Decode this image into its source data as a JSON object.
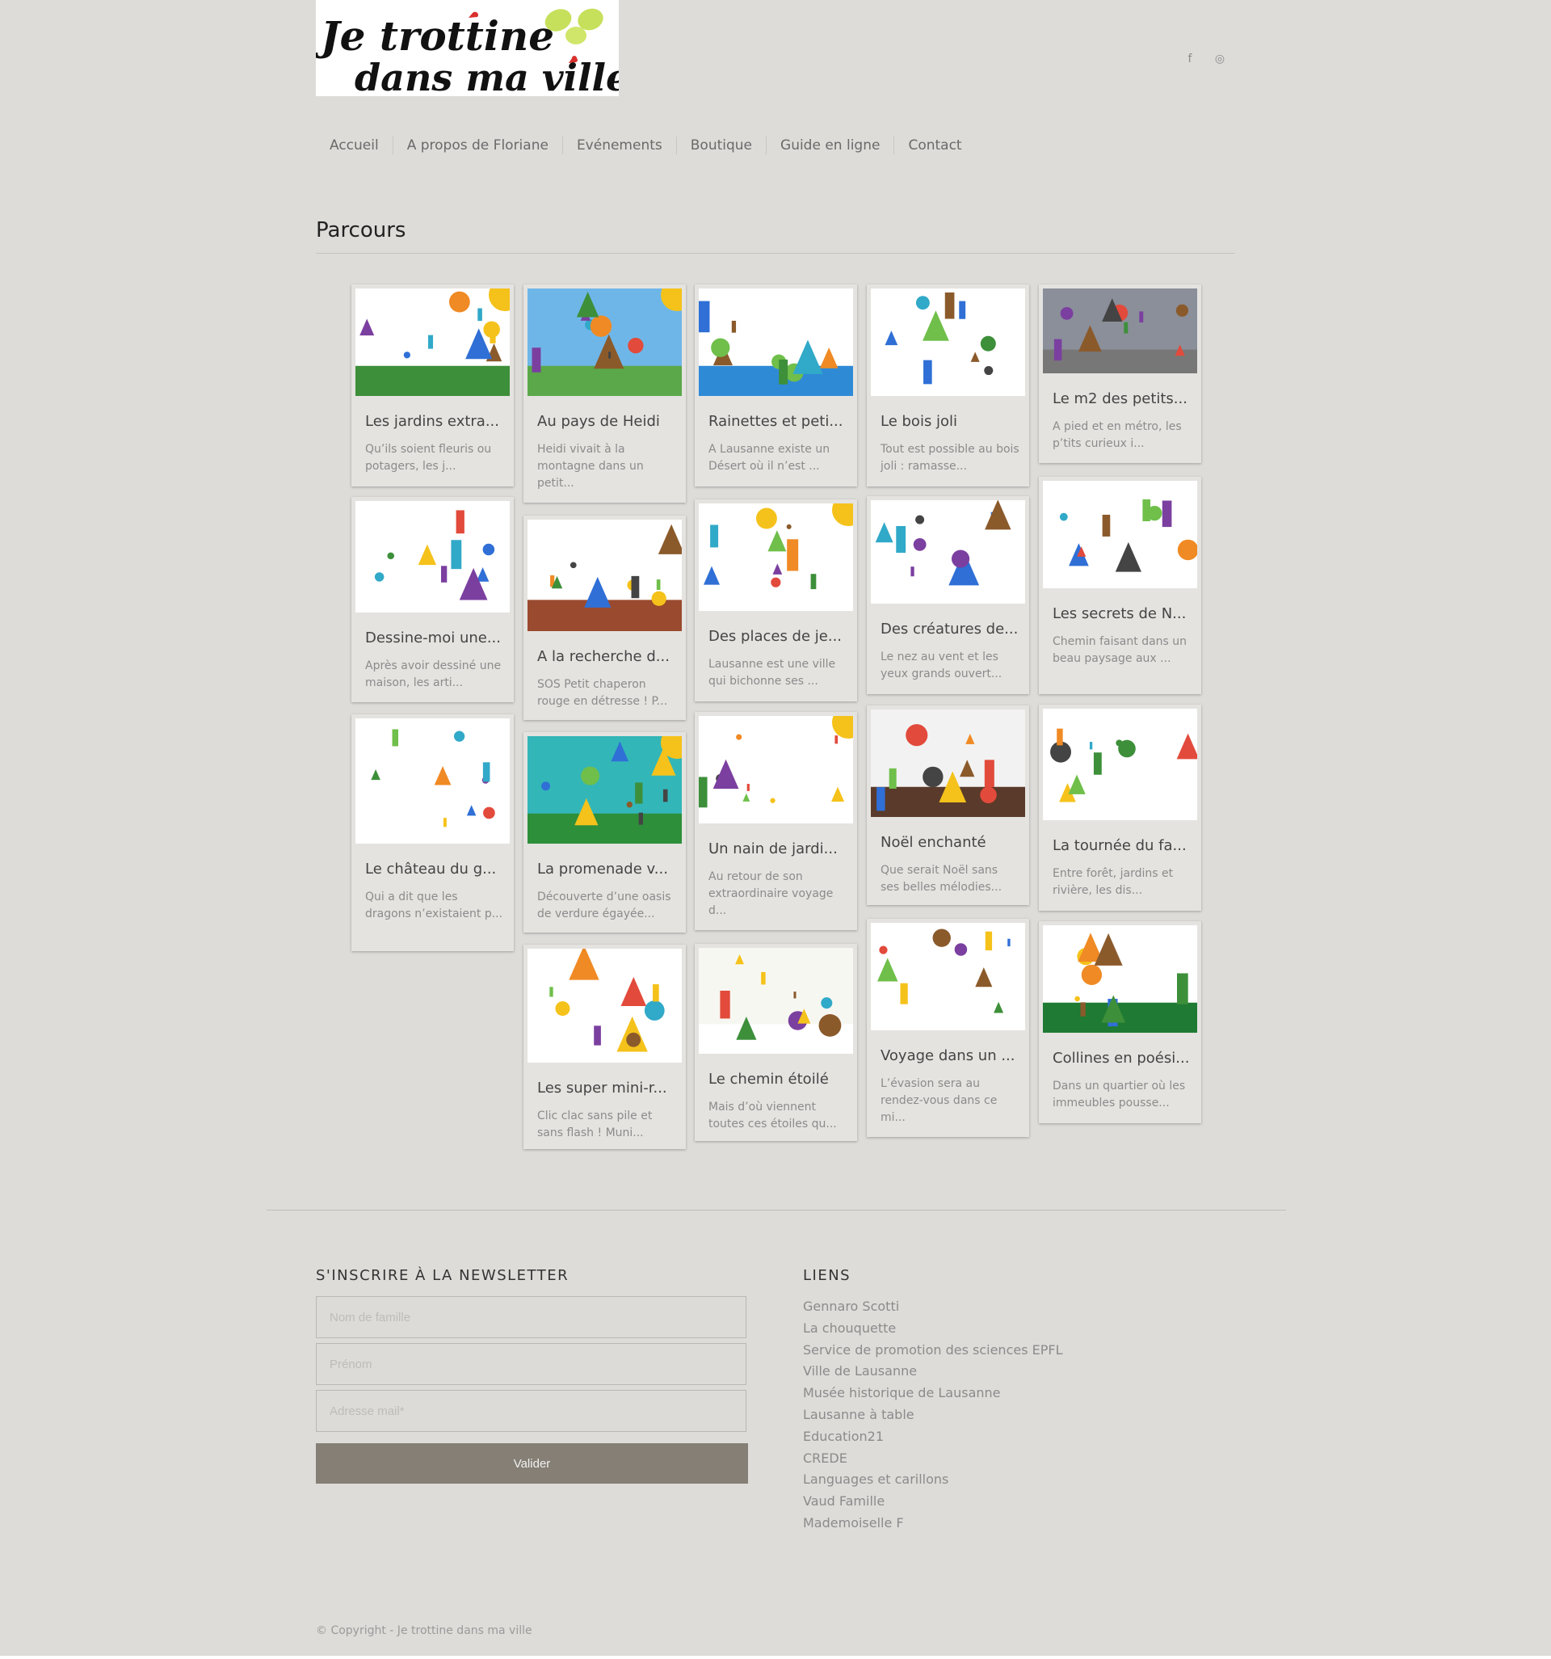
{
  "header": {
    "logo_text": [
      "Je trottine",
      "dans ma ville"
    ],
    "social": {
      "facebook_icon": "f",
      "instagram_icon": "◎"
    }
  },
  "nav": {
    "items": [
      "Accueil",
      "A propos de Floriane",
      "Evénements",
      "Boutique",
      "Guide en ligne",
      "Contact"
    ]
  },
  "page": {
    "title": "Parcours"
  },
  "cards": [
    {
      "title": "Les jardins extra...",
      "excerpt": "Qu’ils soient fleuris ou potagers, les j...",
      "icon": "garden-drawing"
    },
    {
      "title": "Au pays de Heidi",
      "excerpt": "Heidi vivait à la montagne dans un petit...",
      "icon": "mountain-drawing"
    },
    {
      "title": "Rainettes et peti...",
      "excerpt": "A Lausanne existe un Désert où il n’est ...",
      "icon": "frog-drawing"
    },
    {
      "title": "Le bois joli",
      "excerpt": "Tout est possible au bois joli : ramasse...",
      "icon": "forest-drawing"
    },
    {
      "title": "Le m2 des petits...",
      "excerpt": "A pied et en métro, les p’tits curieux i...",
      "icon": "metro-drawing"
    },
    {
      "title": "Dessine-moi une...",
      "excerpt": "Après avoir dessiné une maison, les arti...",
      "icon": "house-drawing"
    },
    {
      "title": "A la recherche d...",
      "excerpt": "SOS Petit chaperon rouge en détresse ! P...",
      "icon": "wood-drawing"
    },
    {
      "title": "Des places de je...",
      "excerpt": "Lausanne est une ville qui bichonne ses ...",
      "icon": "playground-drawing"
    },
    {
      "title": "Des créatures de...",
      "excerpt": "Le nez au vent et les yeux grands ouvert...",
      "icon": "creatures-drawing"
    },
    {
      "title": "Les secrets de N...",
      "excerpt": "Chemin faisant dans un beau paysage aux ...",
      "icon": "night-drawing"
    },
    {
      "title": "Le château du g...",
      "excerpt": "Qui a dit que les dragons n’existaient p...",
      "icon": "castle-drawing"
    },
    {
      "title": "La promenade v...",
      "excerpt": "Découverte d’une oasis de verdure égayée...",
      "icon": "hills-drawing"
    },
    {
      "title": "Un nain de jardi...",
      "excerpt": "Au retour de son extraordinaire voyage d...",
      "icon": "gnome-drawing"
    },
    {
      "title": "Noël enchanté",
      "excerpt": "Que serait Noël sans ses belles mélodies...",
      "icon": "church-drawing"
    },
    {
      "title": "La tournée du fa...",
      "excerpt": "Entre forêt, jardins et rivière, les dis...",
      "icon": "postman-drawing"
    },
    {
      "title": "Les super mini-r...",
      "excerpt": "Clic clac sans pile et sans flash ! Muni...",
      "icon": "frames-drawing"
    },
    {
      "title": "Le chemin étoilé",
      "excerpt": "Mais d’où viennent toutes ces étoiles qu...",
      "icon": "nativity-drawing"
    },
    {
      "title": "Voyage dans un ...",
      "excerpt": "L’évasion sera au rendez-vous dans ce mi...",
      "icon": "suitcase-drawing"
    },
    {
      "title": "Collines en poési...",
      "excerpt": "Dans un quartier où les immeubles pousse...",
      "icon": "green-hills-drawing"
    }
  ],
  "newsletter": {
    "title": "S'INSCRIRE À LA NEWSLETTER",
    "lastname_placeholder": "Nom de famille",
    "firstname_placeholder": "Prénom",
    "email_placeholder": "Adresse mail*",
    "submit_label": "Valider"
  },
  "links": {
    "title": "LIENS",
    "items": [
      "Gennaro Scotti",
      "La chouquette",
      "Service de promotion des sciences EPFL",
      "Ville de Lausanne",
      "Musée historique de Lausanne",
      "Lausanne à table",
      "Education21",
      "CREDE",
      "Languages et carillons",
      "Vaud Famille",
      "Mademoiselle F"
    ]
  },
  "footer": {
    "copyright": "© Copyright - Je trottine dans ma ville"
  },
  "colors": {
    "background": "#dddcd9",
    "button": "#857f75",
    "card": "#e4e3e0"
  }
}
